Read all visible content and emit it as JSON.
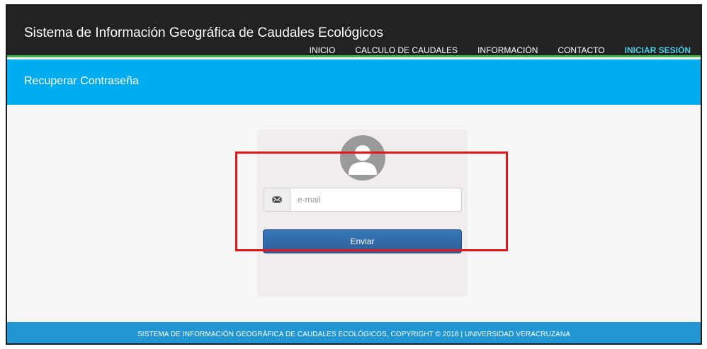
{
  "header": {
    "brand": "Sistema de Información Geográfica de Caudales Ecológicos",
    "nav": [
      {
        "label": "INICIO"
      },
      {
        "label": "CALCULO DE CAUDALES"
      },
      {
        "label": "INFORMACIÓN"
      },
      {
        "label": "CONTACTO"
      },
      {
        "label": "INICIAR SESIÓN",
        "active": true
      }
    ]
  },
  "band": {
    "title": "Recuperar Contraseña"
  },
  "form": {
    "avatar_icon": "user-icon",
    "email_icon": "envelope-icon",
    "email_placeholder": "e-mail",
    "email_value": "",
    "submit_label": "Enviar"
  },
  "footer": {
    "text": "SISTEMA DE INFORMACIÓN GEOGRÁFICA DE CAUDALES ECOLÓGICOS, COPYRIGHT © 2018 | UNIVERSIDAD VERACRUZANA"
  },
  "colors": {
    "topbar": "#222222",
    "topbar_underline": "#3fb54a",
    "band": "#00aef0",
    "active_nav": "#4ccde6",
    "button": "#2f6aa8",
    "footer": "#2196d3",
    "highlight": "#e0161b"
  }
}
